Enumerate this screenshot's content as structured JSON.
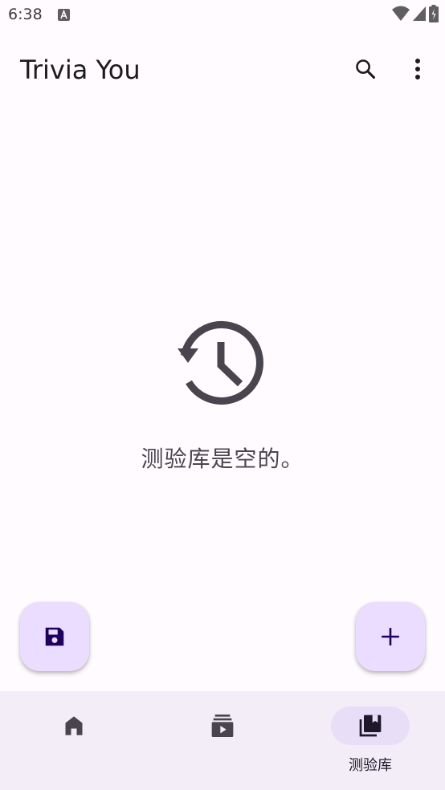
{
  "status_bar": {
    "time": "6:38"
  },
  "app_bar": {
    "title": "Trivia You"
  },
  "empty_state": {
    "message": "测验库是空的。"
  },
  "bottom_nav": {
    "items": [
      {
        "icon": "home-icon",
        "label": "",
        "selected": false
      },
      {
        "icon": "play-collection-icon",
        "label": "",
        "selected": false
      },
      {
        "icon": "library-icon",
        "label": "测验库",
        "selected": true
      }
    ]
  },
  "colors": {
    "background": "#fffbfe",
    "fab_container": "#eaddff",
    "fab_icon": "#21005d",
    "nav_background": "#f3edf7",
    "nav_active_pill": "#e8def8",
    "icon": "#49454f"
  }
}
